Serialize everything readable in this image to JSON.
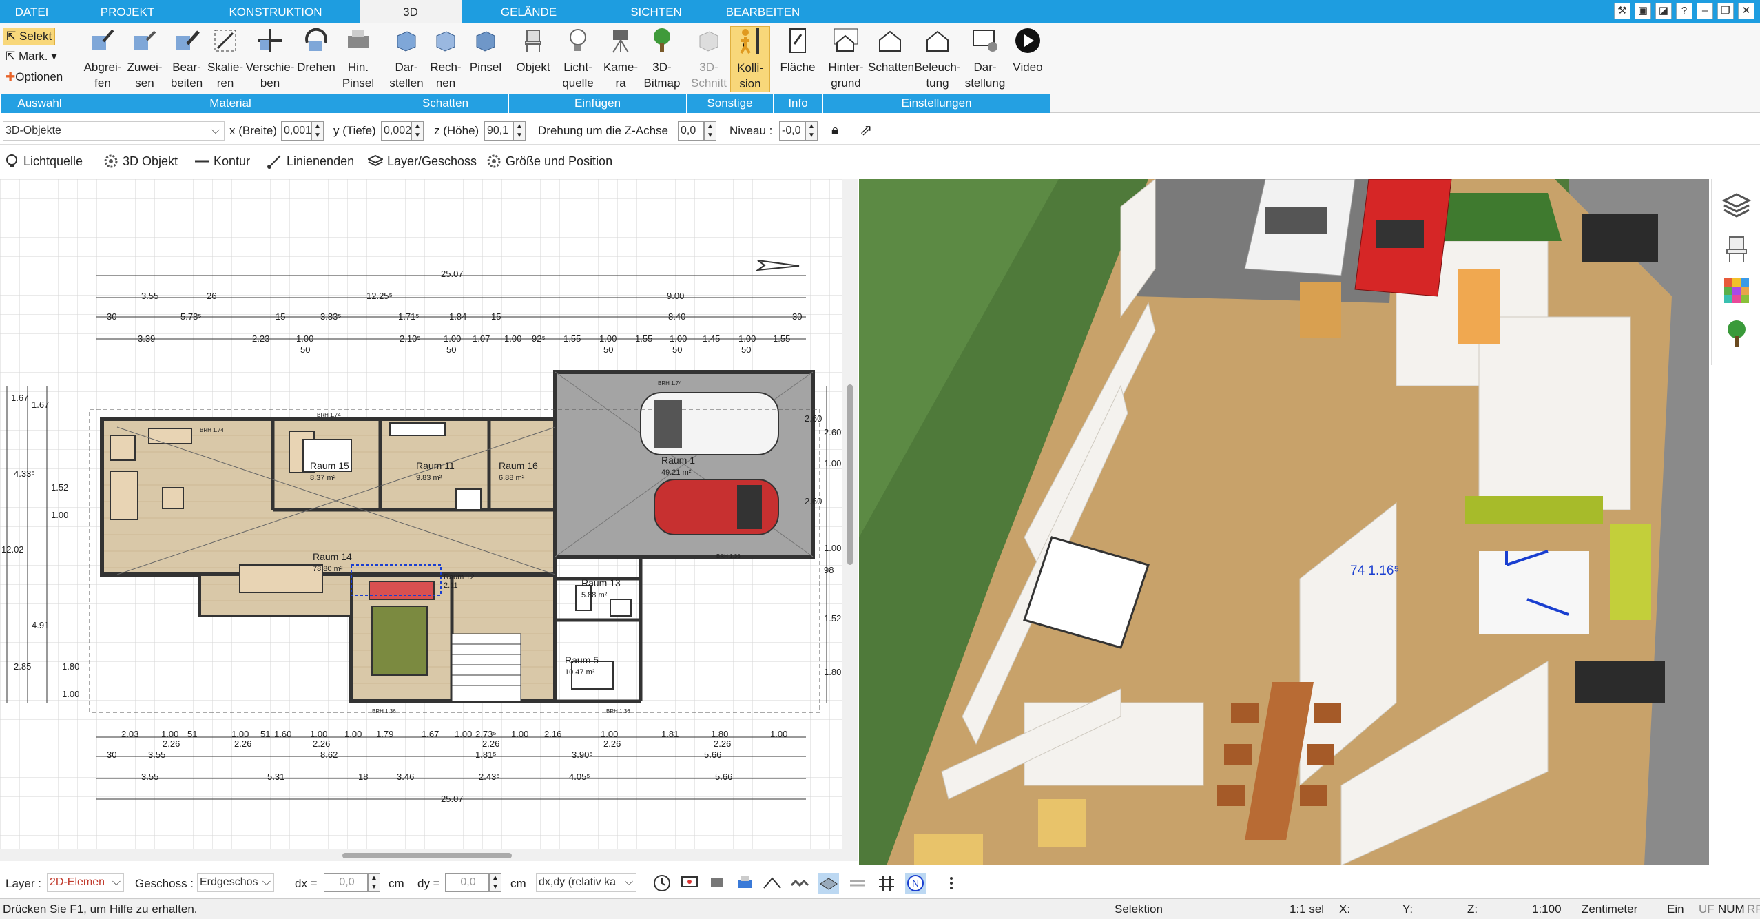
{
  "menubar": {
    "tabs": [
      "DATEI",
      "PROJEKT",
      "KONSTRUKTION",
      "3D",
      "GELÄNDE",
      "SICHTEN",
      "BEARBEITEN"
    ],
    "active_tab": "3D",
    "colors": {
      "bar": "#1e9de0",
      "active_tab_bg": "#f2f2f2"
    }
  },
  "ribbon": {
    "auswahl": {
      "selekt": "Selekt",
      "mark": "Mark.",
      "optionen": "Optionen"
    },
    "buttons": {
      "abgreifen": "Abgrei-\nfen",
      "zuweisen": "Zuwei-\nsen",
      "bearbeiten": "Bear-\nbeiten",
      "skalieren": "Skalie-\nren",
      "verschieben": "Verschie-\nben",
      "drehen": "Drehen",
      "hin_pinsel": "Hin.\nPinsel",
      "darstellen": "Dar-\nstellen",
      "rechnen": "Rech-\nnen",
      "pinsel": "Pinsel",
      "objekt": "Objekt",
      "lichtquelle": "Licht-\nquelle",
      "kamera": "Kame-\nra",
      "bitmap": "3D-\nBitmap",
      "schnitt": "3D-\nSchnitt",
      "kollision": "Kolli-\nsion",
      "flaeche": "Fläche",
      "hintergrund": "Hinter-\ngrund",
      "schatten": "Schatten",
      "beleuchtung": "Beleuch-\ntung",
      "darstellung": "Dar-\nstellung",
      "video": "Video"
    },
    "groups": {
      "auswahl": "Auswahl",
      "material": "Material",
      "schatten": "Schatten",
      "einfuegen": "Einfügen",
      "sonstige": "Sonstige",
      "info": "Info",
      "einstellungen": "Einstellungen"
    },
    "colors": {
      "group_bar": "#24a0e2",
      "active_button": "#f8d77a"
    }
  },
  "propbar": {
    "object_select": "3D-Objekte",
    "x_label": "x (Breite)",
    "x_value": "0,001",
    "y_label": "y (Tiefe)",
    "y_value": "0,002",
    "z_label": "z (Höhe)",
    "z_value": "90,1",
    "rot_label": "Drehung um die Z-Achse",
    "rot_value": "0,0",
    "niveau_label": "Niveau :",
    "niveau_value": "-0,0"
  },
  "toolbar2": {
    "lichtquelle": "Lichtquelle",
    "objekt3d": "3D Objekt",
    "kontur": "Kontur",
    "linienenden": "Linienenden",
    "layer": "Layer/Geschoss",
    "groesse": "Größe und Position"
  },
  "plan": {
    "dims_top": {
      "total": "25.07",
      "a": "3.55",
      "b": "26",
      "c": "12.25⁵",
      "d": "9.00",
      "e": "30",
      "f": "5.78⁵",
      "g": "15",
      "h": "3.83⁵",
      "i": "1.71⁵",
      "j": "1.84",
      "k": "15",
      "l": "8.40",
      "m": "30"
    },
    "dims_row3": [
      "3.39",
      "2.23",
      "1.00",
      "2.10⁵",
      "1.00",
      "1.07",
      "1.00",
      "92⁵",
      "1.55",
      "1.00",
      "1.55",
      "1.00",
      "1.45",
      "1.00",
      "1.55"
    ],
    "dims_row3_sub": [
      "50",
      "50",
      "50",
      "50",
      "50"
    ],
    "dims_bottom": {
      "row1": [
        "2.03",
        "1.00",
        "51",
        "1.00",
        "51",
        "1.00",
        "1.60",
        "1.00",
        "1.79",
        "1.67",
        "1.00",
        "2.73⁵",
        "1.00",
        "2.16",
        "1.00",
        "1.81",
        "1.80",
        "1.00"
      ],
      "row1_sub": [
        "2.26",
        "2.26",
        "2.26",
        "2.26",
        "2.26",
        "2.26"
      ],
      "row2": [
        "30",
        "3.55",
        "8.62",
        "1.81⁵",
        "3.90⁵",
        "5.66"
      ],
      "row3": [
        "3.55",
        "5.31",
        "18",
        "3.46",
        "2.43⁵",
        "4.05⁵",
        "5.66"
      ],
      "total": "25.07"
    },
    "dims_left": [
      "1.67",
      "1.67",
      "4.33⁵",
      "1.52",
      "1.00",
      "2.85",
      "1.80",
      "1.00",
      "4.91",
      "12.02"
    ],
    "dims_right": [
      "2.60",
      "2.60",
      "1.00",
      "2.60",
      "1.00",
      "98",
      "1.52⁵",
      "1.80"
    ],
    "rooms": [
      {
        "name": "Raum 1",
        "area": "49.21 m²"
      },
      {
        "name": "Raum 15",
        "area": "8.37 m²"
      },
      {
        "name": "Raum 11",
        "area": "9.83 m²"
      },
      {
        "name": "Raum 16",
        "area": "6.88 m²"
      },
      {
        "name": "Raum 14",
        "area": "78.80 m²"
      },
      {
        "name": "Raum 13",
        "area": "5.88 m²"
      },
      {
        "name": "Raum 5",
        "area": "10.47 m²"
      },
      {
        "name": "Raum 12",
        "area": "2.11"
      }
    ],
    "brh": [
      "BRH 1.74",
      "BRH 1.74",
      "BRH 1.74",
      "BRH 1.36",
      "BRH 1.36",
      "BRH 1.36"
    ]
  },
  "view3d": {
    "dimension_label": "74 1.16⁵",
    "colors": {
      "grass": "#4f7a3a",
      "floor": "#c8a26a",
      "walls": "#f4f2ee"
    }
  },
  "sidepanel": [
    "layers-icon",
    "chair-icon",
    "palette-icon",
    "tree-icon"
  ],
  "bottombar": {
    "layer_label": "Layer :",
    "layer_value": "2D-Elemen",
    "geschoss_label": "Geschoss :",
    "geschoss_value": "Erdgeschos",
    "dx_label": "dx =",
    "dx_value": "0,0",
    "dx_unit": "cm",
    "dy_label": "dy =",
    "dy_value": "0,0",
    "dy_unit": "cm",
    "mode_value": "dx,dy (relativ ka"
  },
  "statusbar": {
    "help": "Drücken Sie F1, um Hilfe zu erhalten.",
    "mode": "Selektion",
    "sel": "1:1 sel",
    "x": "X:",
    "y": "Y:",
    "z": "Z:",
    "scale": "1:100",
    "unit": "Zentimeter",
    "ein": "Ein",
    "uf": "UF",
    "num": "NUM",
    "rf": "RF"
  }
}
